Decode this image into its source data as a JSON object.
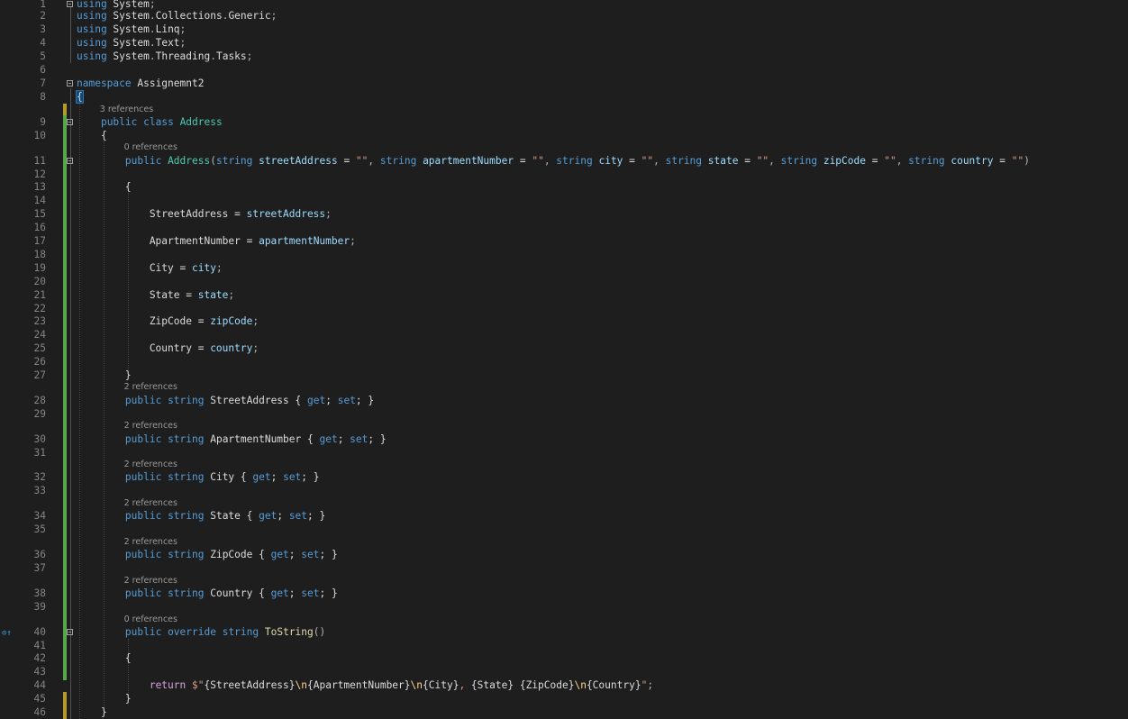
{
  "editor": {
    "lines": [
      {
        "n": "1",
        "code": [
          {
            "c": "kw",
            "t": "using"
          },
          {
            "c": "ns",
            "t": " System"
          },
          {
            "c": "pun",
            "t": ";"
          }
        ]
      },
      {
        "n": "2",
        "code": [
          {
            "c": "kw",
            "t": "using"
          },
          {
            "c": "ns",
            "t": " System"
          },
          {
            "c": "pun",
            "t": "."
          },
          {
            "c": "ns",
            "t": "Collections"
          },
          {
            "c": "pun",
            "t": "."
          },
          {
            "c": "ns",
            "t": "Generic"
          },
          {
            "c": "pun",
            "t": ";"
          }
        ]
      },
      {
        "n": "3",
        "code": [
          {
            "c": "kw",
            "t": "using"
          },
          {
            "c": "ns",
            "t": " System"
          },
          {
            "c": "pun",
            "t": "."
          },
          {
            "c": "ns",
            "t": "Linq"
          },
          {
            "c": "pun",
            "t": ";"
          }
        ]
      },
      {
        "n": "4",
        "code": [
          {
            "c": "kw",
            "t": "using"
          },
          {
            "c": "ns",
            "t": " System"
          },
          {
            "c": "pun",
            "t": "."
          },
          {
            "c": "ns",
            "t": "Text"
          },
          {
            "c": "pun",
            "t": ";"
          }
        ]
      },
      {
        "n": "5",
        "code": [
          {
            "c": "kw",
            "t": "using"
          },
          {
            "c": "ns",
            "t": " System"
          },
          {
            "c": "pun",
            "t": "."
          },
          {
            "c": "ns",
            "t": "Threading"
          },
          {
            "c": "pun",
            "t": "."
          },
          {
            "c": "ns",
            "t": "Tasks"
          },
          {
            "c": "pun",
            "t": ";"
          }
        ]
      },
      {
        "n": "6",
        "code": []
      },
      {
        "n": "7",
        "code": [
          {
            "c": "kw",
            "t": "namespace"
          },
          {
            "c": "ns",
            "t": " Assignemnt2"
          }
        ]
      },
      {
        "n": "8",
        "code": [
          {
            "c": "brace-hl",
            "t": "{"
          }
        ]
      },
      {
        "n": "9",
        "lens": "3 references",
        "code": [
          {
            "c": "id",
            "t": "    "
          },
          {
            "c": "kw",
            "t": "public"
          },
          {
            "c": "id",
            "t": " "
          },
          {
            "c": "kw",
            "t": "class"
          },
          {
            "c": "id",
            "t": " "
          },
          {
            "c": "ty",
            "t": "Address"
          }
        ]
      },
      {
        "n": "10",
        "code": [
          {
            "c": "id",
            "t": "    {"
          }
        ]
      },
      {
        "n": "11",
        "lens": "0 references",
        "code": [
          {
            "c": "id",
            "t": "        "
          },
          {
            "c": "kw",
            "t": "public"
          },
          {
            "c": "id",
            "t": " "
          },
          {
            "c": "ty",
            "t": "Address"
          },
          {
            "c": "pun",
            "t": "("
          },
          {
            "c": "kw",
            "t": "string"
          },
          {
            "c": "id",
            "t": " "
          },
          {
            "c": "par",
            "t": "streetAddress"
          },
          {
            "c": "id",
            "t": " = "
          },
          {
            "c": "str",
            "t": "\"\""
          },
          {
            "c": "pun",
            "t": ", "
          },
          {
            "c": "kw",
            "t": "string"
          },
          {
            "c": "id",
            "t": " "
          },
          {
            "c": "par",
            "t": "apartmentNumber"
          },
          {
            "c": "id",
            "t": " = "
          },
          {
            "c": "str",
            "t": "\"\""
          },
          {
            "c": "pun",
            "t": ", "
          },
          {
            "c": "kw",
            "t": "string"
          },
          {
            "c": "id",
            "t": " "
          },
          {
            "c": "par",
            "t": "city"
          },
          {
            "c": "id",
            "t": " = "
          },
          {
            "c": "str",
            "t": "\"\""
          },
          {
            "c": "pun",
            "t": ", "
          },
          {
            "c": "kw",
            "t": "string"
          },
          {
            "c": "id",
            "t": " "
          },
          {
            "c": "par",
            "t": "state"
          },
          {
            "c": "id",
            "t": " = "
          },
          {
            "c": "str",
            "t": "\"\""
          },
          {
            "c": "pun",
            "t": ", "
          },
          {
            "c": "kw",
            "t": "string"
          },
          {
            "c": "id",
            "t": " "
          },
          {
            "c": "par",
            "t": "zipCode"
          },
          {
            "c": "id",
            "t": " = "
          },
          {
            "c": "str",
            "t": "\"\""
          },
          {
            "c": "pun",
            "t": ", "
          },
          {
            "c": "kw",
            "t": "string"
          },
          {
            "c": "id",
            "t": " "
          },
          {
            "c": "par",
            "t": "country"
          },
          {
            "c": "id",
            "t": " = "
          },
          {
            "c": "str",
            "t": "\"\""
          },
          {
            "c": "pun",
            "t": ")"
          }
        ]
      },
      {
        "n": "12",
        "code": []
      },
      {
        "n": "13",
        "code": [
          {
            "c": "id",
            "t": "        {"
          }
        ]
      },
      {
        "n": "14",
        "code": []
      },
      {
        "n": "15",
        "code": [
          {
            "c": "id",
            "t": "            StreetAddress = "
          },
          {
            "c": "par",
            "t": "streetAddress"
          },
          {
            "c": "pun",
            "t": ";"
          }
        ]
      },
      {
        "n": "16",
        "code": []
      },
      {
        "n": "17",
        "code": [
          {
            "c": "id",
            "t": "            ApartmentNumber = "
          },
          {
            "c": "par",
            "t": "apartmentNumber"
          },
          {
            "c": "pun",
            "t": ";"
          }
        ]
      },
      {
        "n": "18",
        "code": []
      },
      {
        "n": "19",
        "code": [
          {
            "c": "id",
            "t": "            City = "
          },
          {
            "c": "par",
            "t": "city"
          },
          {
            "c": "pun",
            "t": ";"
          }
        ]
      },
      {
        "n": "20",
        "code": []
      },
      {
        "n": "21",
        "code": [
          {
            "c": "id",
            "t": "            State = "
          },
          {
            "c": "par",
            "t": "state"
          },
          {
            "c": "pun",
            "t": ";"
          }
        ]
      },
      {
        "n": "22",
        "code": []
      },
      {
        "n": "23",
        "code": [
          {
            "c": "id",
            "t": "            ZipCode = "
          },
          {
            "c": "par",
            "t": "zipCode"
          },
          {
            "c": "pun",
            "t": ";"
          }
        ]
      },
      {
        "n": "24",
        "code": []
      },
      {
        "n": "25",
        "code": [
          {
            "c": "id",
            "t": "            Country = "
          },
          {
            "c": "par",
            "t": "country"
          },
          {
            "c": "pun",
            "t": ";"
          }
        ]
      },
      {
        "n": "26",
        "code": []
      },
      {
        "n": "27",
        "code": [
          {
            "c": "id",
            "t": "        }"
          }
        ]
      },
      {
        "n": "28",
        "lens": "2 references",
        "code": [
          {
            "c": "id",
            "t": "        "
          },
          {
            "c": "kw",
            "t": "public"
          },
          {
            "c": "id",
            "t": " "
          },
          {
            "c": "kw",
            "t": "string"
          },
          {
            "c": "id",
            "t": " StreetAddress { "
          },
          {
            "c": "kw",
            "t": "get"
          },
          {
            "c": "id",
            "t": "; "
          },
          {
            "c": "kw",
            "t": "set"
          },
          {
            "c": "id",
            "t": "; }"
          }
        ]
      },
      {
        "n": "29",
        "code": []
      },
      {
        "n": "30",
        "lens": "2 references",
        "code": [
          {
            "c": "id",
            "t": "        "
          },
          {
            "c": "kw",
            "t": "public"
          },
          {
            "c": "id",
            "t": " "
          },
          {
            "c": "kw",
            "t": "string"
          },
          {
            "c": "id",
            "t": " ApartmentNumber { "
          },
          {
            "c": "kw",
            "t": "get"
          },
          {
            "c": "id",
            "t": "; "
          },
          {
            "c": "kw",
            "t": "set"
          },
          {
            "c": "id",
            "t": "; }"
          }
        ]
      },
      {
        "n": "31",
        "code": []
      },
      {
        "n": "32",
        "lens": "2 references",
        "code": [
          {
            "c": "id",
            "t": "        "
          },
          {
            "c": "kw",
            "t": "public"
          },
          {
            "c": "id",
            "t": " "
          },
          {
            "c": "kw",
            "t": "string"
          },
          {
            "c": "id",
            "t": " City { "
          },
          {
            "c": "kw",
            "t": "get"
          },
          {
            "c": "id",
            "t": "; "
          },
          {
            "c": "kw",
            "t": "set"
          },
          {
            "c": "id",
            "t": "; }"
          }
        ]
      },
      {
        "n": "33",
        "code": []
      },
      {
        "n": "34",
        "lens": "2 references",
        "code": [
          {
            "c": "id",
            "t": "        "
          },
          {
            "c": "kw",
            "t": "public"
          },
          {
            "c": "id",
            "t": " "
          },
          {
            "c": "kw",
            "t": "string"
          },
          {
            "c": "id",
            "t": " State { "
          },
          {
            "c": "kw",
            "t": "get"
          },
          {
            "c": "id",
            "t": "; "
          },
          {
            "c": "kw",
            "t": "set"
          },
          {
            "c": "id",
            "t": "; }"
          }
        ]
      },
      {
        "n": "35",
        "code": []
      },
      {
        "n": "36",
        "lens": "2 references",
        "code": [
          {
            "c": "id",
            "t": "        "
          },
          {
            "c": "kw",
            "t": "public"
          },
          {
            "c": "id",
            "t": " "
          },
          {
            "c": "kw",
            "t": "string"
          },
          {
            "c": "id",
            "t": " ZipCode { "
          },
          {
            "c": "kw",
            "t": "get"
          },
          {
            "c": "id",
            "t": "; "
          },
          {
            "c": "kw",
            "t": "set"
          },
          {
            "c": "id",
            "t": "; }"
          }
        ]
      },
      {
        "n": "37",
        "code": []
      },
      {
        "n": "38",
        "lens": "2 references",
        "code": [
          {
            "c": "id",
            "t": "        "
          },
          {
            "c": "kw",
            "t": "public"
          },
          {
            "c": "id",
            "t": " "
          },
          {
            "c": "kw",
            "t": "string"
          },
          {
            "c": "id",
            "t": " Country { "
          },
          {
            "c": "kw",
            "t": "get"
          },
          {
            "c": "id",
            "t": "; "
          },
          {
            "c": "kw",
            "t": "set"
          },
          {
            "c": "id",
            "t": "; }"
          }
        ]
      },
      {
        "n": "39",
        "code": []
      },
      {
        "n": "40",
        "lens": "0 references",
        "code": [
          {
            "c": "id",
            "t": "        "
          },
          {
            "c": "kw",
            "t": "public"
          },
          {
            "c": "id",
            "t": " "
          },
          {
            "c": "kw",
            "t": "override"
          },
          {
            "c": "id",
            "t": " "
          },
          {
            "c": "kw",
            "t": "string"
          },
          {
            "c": "id",
            "t": " "
          },
          {
            "c": "fn",
            "t": "ToString"
          },
          {
            "c": "pun",
            "t": "()"
          }
        ]
      },
      {
        "n": "41",
        "code": []
      },
      {
        "n": "42",
        "code": [
          {
            "c": "id",
            "t": "        {"
          }
        ]
      },
      {
        "n": "43",
        "code": []
      },
      {
        "n": "44",
        "code": [
          {
            "c": "id",
            "t": "            "
          },
          {
            "c": "kw2",
            "t": "return"
          },
          {
            "c": "id",
            "t": " "
          },
          {
            "c": "str",
            "t": "$\""
          },
          {
            "c": "id",
            "t": "{StreetAddress}"
          },
          {
            "c": "esc",
            "t": "\\n"
          },
          {
            "c": "id",
            "t": "{ApartmentNumber}"
          },
          {
            "c": "esc",
            "t": "\\n"
          },
          {
            "c": "id",
            "t": "{City}"
          },
          {
            "c": "str",
            "t": ", "
          },
          {
            "c": "id",
            "t": "{State}"
          },
          {
            "c": "str",
            "t": " "
          },
          {
            "c": "id",
            "t": "{ZipCode}"
          },
          {
            "c": "esc",
            "t": "\\n"
          },
          {
            "c": "id",
            "t": "{Country}"
          },
          {
            "c": "str",
            "t": "\""
          },
          {
            "c": "pun",
            "t": ";"
          }
        ]
      },
      {
        "n": "45",
        "code": [
          {
            "c": "id",
            "t": "        }"
          }
        ]
      },
      {
        "n": "46",
        "code": [
          {
            "c": "id",
            "t": "    }"
          }
        ]
      }
    ],
    "override_indicator_icon": "override-arrow-icon"
  }
}
